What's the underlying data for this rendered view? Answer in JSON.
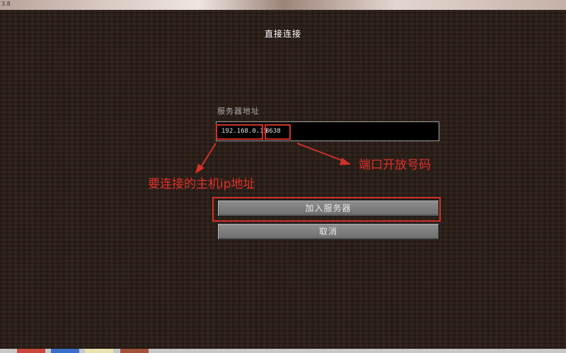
{
  "window": {
    "version_text": "3.8"
  },
  "screen": {
    "title": "直接连接",
    "address_label": "服务器地址",
    "address_input": {
      "ip_part": "192.168.0.1",
      "ip_separator": "5",
      "port_part": "8638"
    },
    "join_button": "加入服务器",
    "cancel_button": "取消"
  },
  "annotations": {
    "ip_note": "要连接的主机ip地址",
    "port_note": "端口开放号码",
    "color": "#d2302a"
  }
}
